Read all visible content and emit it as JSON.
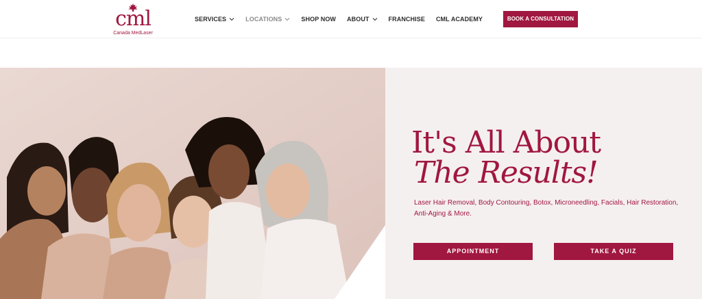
{
  "brand": {
    "logo_mark": "cml",
    "logo_subtitle": "Canada MedLaser",
    "accent_color": "#a0173f"
  },
  "nav": {
    "items": [
      {
        "label": "SERVICES",
        "has_dropdown": true
      },
      {
        "label": "LOCATIONS",
        "has_dropdown": true
      },
      {
        "label": "SHOP NOW",
        "has_dropdown": false
      },
      {
        "label": "ABOUT",
        "has_dropdown": true
      },
      {
        "label": "FRANCHISE",
        "has_dropdown": false
      },
      {
        "label": "CML ACADEMY",
        "has_dropdown": false
      }
    ],
    "cta_label": "BOOK A CONSULTATION"
  },
  "hero": {
    "headline_line1": "It's All About",
    "headline_line2": "The Results!",
    "services_text": "Laser Hair Removal, Body Contouring, Botox, Microneedling, Facials, Hair Restoration, Anti-Aging & More.",
    "appointment_label": "APPOINTMENT",
    "quiz_label": "TAKE A QUIZ",
    "image_icon": "group-of-women-photo"
  }
}
